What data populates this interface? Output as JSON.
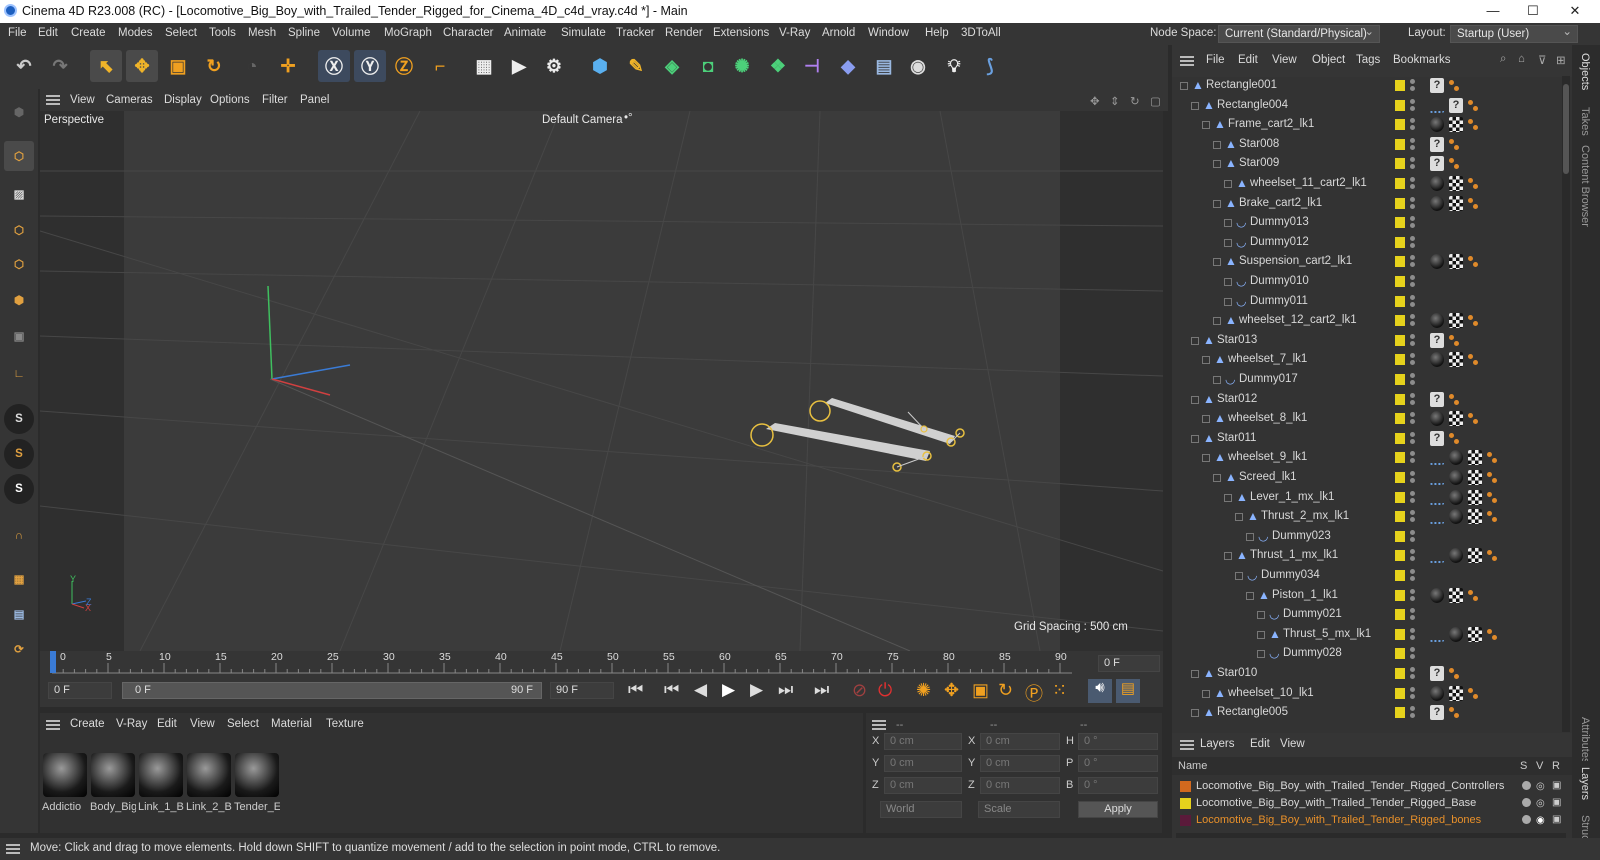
{
  "window": {
    "title": "Cinema 4D R23.008 (RC) - [Locomotive_Big_Boy_with_Trailed_Tender_Rigged_for_Cinema_4D_c4d_vray.c4d *] - Main",
    "minimize": "—",
    "maximize": "☐",
    "close": "✕"
  },
  "menubar": {
    "items": [
      "File",
      "Edit",
      "Create",
      "Modes",
      "Select",
      "Tools",
      "Mesh",
      "Spline",
      "Volume",
      "MoGraph",
      "Character",
      "Animate",
      "Simulate",
      "Tracker",
      "Render",
      "Extensions",
      "V-Ray",
      "Arnold",
      "Window",
      "Help",
      "3DToAll"
    ],
    "node_space_label": "Node Space:",
    "node_space_value": "Current (Standard/Physical)",
    "layout_label": "Layout:",
    "layout_value": "Startup (User)"
  },
  "viewport": {
    "menu": [
      "View",
      "Cameras",
      "Display",
      "Options",
      "Filter",
      "Panel"
    ],
    "label": "Perspective",
    "camera": "Default Camera",
    "camera_icon": "•°",
    "grid_spacing": "Grid Spacing : 500 cm",
    "axis_x": "X",
    "axis_y": "Y",
    "axis_z": "Z"
  },
  "timeline": {
    "ticks": [
      "0",
      "5",
      "10",
      "15",
      "20",
      "25",
      "30",
      "35",
      "40",
      "45",
      "50",
      "55",
      "60",
      "65",
      "70",
      "75",
      "80",
      "85",
      "90"
    ],
    "current_frame_field": "0 F",
    "start_field": "0 F",
    "range_start": "0 F",
    "range_end": "90 F",
    "end_field": "90 F"
  },
  "material_manager": {
    "menu": [
      "Create",
      "V-Ray",
      "Edit",
      "View",
      "Select",
      "Material",
      "Texture"
    ],
    "materials": [
      "Addictio",
      "Body_Big",
      "Link_1_B",
      "Link_2_B",
      "Tender_E"
    ]
  },
  "attributes": {
    "headers": [
      "--",
      "--",
      "--"
    ],
    "rows": [
      {
        "l1": "X",
        "v1": "0 cm",
        "l2": "X",
        "v2": "0 cm",
        "l3": "H",
        "v3": "0 °"
      },
      {
        "l1": "Y",
        "v1": "0 cm",
        "l2": "Y",
        "v2": "0 cm",
        "l3": "P",
        "v3": "0 °"
      },
      {
        "l1": "Z",
        "v1": "0 cm",
        "l2": "Z",
        "v2": "0 cm",
        "l3": "B",
        "v3": "0 °"
      }
    ],
    "coord_mode": "World",
    "scale_mode": "Scale",
    "apply": "Apply"
  },
  "object_manager": {
    "menu": [
      "File",
      "Edit",
      "View",
      "Object",
      "Tags",
      "Bookmarks"
    ],
    "objects": [
      {
        "name": "Rectangle001",
        "depth": 0,
        "type": "null",
        "tags": "q"
      },
      {
        "name": "Rectangle004",
        "depth": 1,
        "type": "null",
        "tags": "dq"
      },
      {
        "name": "Frame_cart2_lk1",
        "depth": 2,
        "type": "null",
        "tags": "sc"
      },
      {
        "name": "Star008",
        "depth": 3,
        "type": "null",
        "tags": "q"
      },
      {
        "name": "Star009",
        "depth": 3,
        "type": "null",
        "tags": "q"
      },
      {
        "name": "wheelset_11_cart2_lk1",
        "depth": 4,
        "type": "null",
        "tags": "sc"
      },
      {
        "name": "Brake_cart2_lk1",
        "depth": 3,
        "type": "null",
        "tags": "sc"
      },
      {
        "name": "Dummy013",
        "depth": 4,
        "type": "joint",
        "tags": ""
      },
      {
        "name": "Dummy012",
        "depth": 4,
        "type": "joint",
        "tags": ""
      },
      {
        "name": "Suspension_cart2_lk1",
        "depth": 3,
        "type": "null",
        "tags": "sc"
      },
      {
        "name": "Dummy010",
        "depth": 4,
        "type": "joint",
        "tags": ""
      },
      {
        "name": "Dummy011",
        "depth": 4,
        "type": "joint",
        "tags": ""
      },
      {
        "name": "wheelset_12_cart2_lk1",
        "depth": 3,
        "type": "null",
        "tags": "sc"
      },
      {
        "name": "Star013",
        "depth": 1,
        "type": "null",
        "tags": "q"
      },
      {
        "name": "wheelset_7_lk1",
        "depth": 2,
        "type": "null",
        "tags": "sc"
      },
      {
        "name": "Dummy017",
        "depth": 3,
        "type": "joint",
        "tags": ""
      },
      {
        "name": "Star012",
        "depth": 1,
        "type": "null",
        "tags": "q"
      },
      {
        "name": "wheelset_8_lk1",
        "depth": 2,
        "type": "null",
        "tags": "sc"
      },
      {
        "name": "Star011",
        "depth": 1,
        "type": "null",
        "tags": "q"
      },
      {
        "name": "wheelset_9_lk1",
        "depth": 2,
        "type": "null",
        "tags": "dsc"
      },
      {
        "name": "Screed_lk1",
        "depth": 3,
        "type": "null",
        "tags": "dsc"
      },
      {
        "name": "Lever_1_mx_lk1",
        "depth": 4,
        "type": "null",
        "tags": "dsc"
      },
      {
        "name": "Thrust_2_mx_lk1",
        "depth": 5,
        "type": "null",
        "tags": "dsc"
      },
      {
        "name": "Dummy023",
        "depth": 6,
        "type": "joint",
        "tags": ""
      },
      {
        "name": "Thrust_1_mx_lk1",
        "depth": 4,
        "type": "null",
        "tags": "dsc"
      },
      {
        "name": "Dummy034",
        "depth": 5,
        "type": "joint",
        "tags": ""
      },
      {
        "name": "Piston_1_lk1",
        "depth": 6,
        "type": "null",
        "tags": "sc"
      },
      {
        "name": "Dummy021",
        "depth": 7,
        "type": "joint",
        "tags": ""
      },
      {
        "name": "Thrust_5_mx_lk1",
        "depth": 7,
        "type": "null",
        "tags": "dsc"
      },
      {
        "name": "Dummy028",
        "depth": 7,
        "type": "joint",
        "tags": ""
      },
      {
        "name": "Star010",
        "depth": 1,
        "type": "null",
        "tags": "q"
      },
      {
        "name": "wheelset_10_lk1",
        "depth": 2,
        "type": "null",
        "tags": "sc"
      },
      {
        "name": "Rectangle005",
        "depth": 1,
        "type": "null",
        "tags": "q"
      }
    ]
  },
  "layers": {
    "menu": [
      "Layers",
      "Edit",
      "View"
    ],
    "col_name": "Name",
    "col_s": "S",
    "col_v": "V",
    "col_r": "R",
    "items": [
      {
        "name": "Locomotive_Big_Boy_with_Trailed_Tender_Rigged_Controllers",
        "color": "#d2691e",
        "text_color": "#d8d8d8"
      },
      {
        "name": "Locomotive_Big_Boy_with_Trailed_Tender_Rigged_Base",
        "color": "#e6d21c",
        "text_color": "#d8d8d8"
      },
      {
        "name": "Locomotive_Big_Boy_with_Trailed_Tender_Rigged_bones",
        "color": "#5a1a3a",
        "text_color": "#e8902a"
      }
    ]
  },
  "right_tabs": [
    "Objects",
    "Takes",
    "Content Browser",
    "Attributes",
    "Layers",
    "Structure"
  ],
  "status": "Move: Click and drag to move elements. Hold down SHIFT to quantize movement / add to the selection in point mode, CTRL to remove."
}
